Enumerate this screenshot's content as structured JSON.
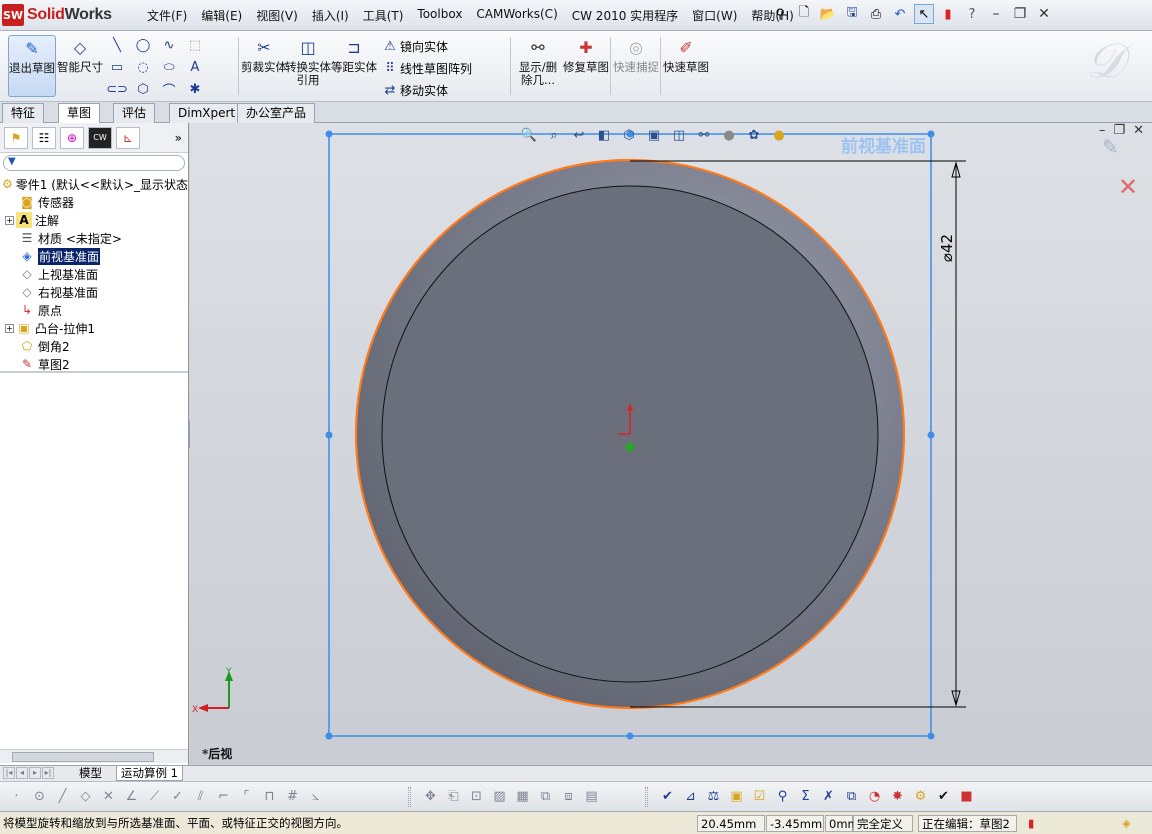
{
  "app": {
    "name_a": "Solid",
    "name_b": "Works",
    "logo_mark": "SW"
  },
  "menus": [
    "文件(F)",
    "编辑(E)",
    "视图(V)",
    "插入(I)",
    "工具(T)",
    "Toolbox",
    "CAMWorks(C)",
    "CW 2010 实用程序",
    "窗口(W)",
    "帮助(H)"
  ],
  "cmd": {
    "exit_sketch": "退出草图",
    "smart_dim": "智能尺寸",
    "trim": "剪裁实体",
    "convert": "转换实体引用",
    "offset": "等距实体",
    "mirror": "镜向实体",
    "linear_pattern": "线性草图阵列",
    "move": "移动实体",
    "show_delete": "显示/删除几...",
    "repair": "修复草图",
    "quick_snap": "快速捕捉",
    "rapid_sketch": "快速草图"
  },
  "cm_tabs": [
    "特征",
    "草图",
    "评估",
    "DimXpert",
    "办公室产品"
  ],
  "cm_active_tab": "草图",
  "tree": {
    "root": "零件1 (默认<<默认>_显示状态",
    "items": [
      {
        "label": "传感器",
        "icon": "sensor-icon"
      },
      {
        "label": "注解",
        "icon": "annotation-icon",
        "expand": "+"
      },
      {
        "label": "材质 <未指定>",
        "icon": "material-icon"
      },
      {
        "label": "前视基准面",
        "icon": "plane-icon",
        "selected": true
      },
      {
        "label": "上视基准面",
        "icon": "plane-icon"
      },
      {
        "label": "右视基准面",
        "icon": "plane-icon"
      },
      {
        "label": "原点",
        "icon": "origin-icon"
      },
      {
        "label": "凸台-拉伸1",
        "icon": "extrude-icon",
        "expand": "+"
      },
      {
        "label": "倒角2",
        "icon": "chamfer-icon"
      },
      {
        "label": "草图2",
        "icon": "sketch-icon"
      }
    ]
  },
  "graphics": {
    "plane_label": "前视基准面",
    "dimension": "⌀42",
    "view_name": "*后视",
    "triad_x": "X",
    "triad_y": "Y",
    "colors": {
      "disk_outer": "#7a7e8c",
      "disk_inner": "#6b6f7c",
      "plane_border": "#3c8ee8",
      "edge_highlight": "#ff7a1a"
    }
  },
  "model_tabs": [
    "模型",
    "运动算例 1"
  ],
  "model_active_tab": "运动算例 1",
  "status": {
    "message": "将模型旋转和缩放到与所选基准面、平面、或特征正交的视图方向。",
    "x": "20.45mm",
    "y": "-3.45mm",
    "z": "0mm",
    "definition": "完全定义",
    "editing": "正在编辑：草图2"
  }
}
